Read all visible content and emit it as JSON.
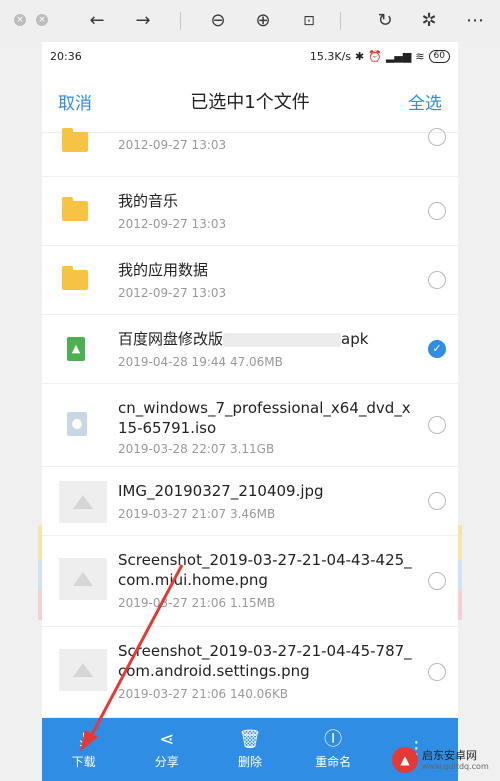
{
  "viewer": {
    "icons": [
      "close-icon",
      "back-icon",
      "forward-icon",
      "zoom-out-icon",
      "zoom-in-icon",
      "fit-icon",
      "rotate-icon",
      "magic-icon",
      "more-icon"
    ]
  },
  "status": {
    "time": "20:36",
    "speed": "15.3K/s",
    "battery": "60"
  },
  "header": {
    "cancel": "取消",
    "title": "已选中1个文件",
    "select_all": "全选"
  },
  "files": [
    {
      "name": "",
      "meta": "2012-09-27  13:03",
      "type": "folder",
      "checked": false
    },
    {
      "name": "我的音乐",
      "meta": "2012-09-27  13:03",
      "type": "folder",
      "checked": false
    },
    {
      "name": "我的应用数据",
      "meta": "2012-09-27  13:03",
      "type": "folder",
      "checked": false
    },
    {
      "name_prefix": "百度网盘修改版",
      "name_suffix": "apk",
      "meta": "2019-04-28  19:44  47.06MB",
      "type": "apk",
      "checked": true
    },
    {
      "name": "cn_windows_7_professional_x64_dvd_x15-65791.iso",
      "meta": "2019-03-28  22:07  3.11GB",
      "type": "iso",
      "checked": false
    },
    {
      "name": "IMG_20190327_210409.jpg",
      "meta": "2019-03-27  21:07  3.46MB",
      "type": "image",
      "checked": false
    },
    {
      "name": "Screenshot_2019-03-27-21-04-43-425_com.miui.home.png",
      "meta": "2019-03-27  21:06  1.15MB",
      "type": "image",
      "checked": false
    },
    {
      "name": "Screenshot_2019-03-27-21-04-45-787_com.android.settings.png",
      "meta": "2019-03-27  21:06  140.06KB",
      "type": "image",
      "checked": false
    }
  ],
  "bottom_bar": {
    "download": "下载",
    "share": "分享",
    "delete": "删除",
    "rename": "重命名"
  },
  "watermark": {
    "title": "启东安卓网",
    "url": "www.qdltdq.com"
  },
  "colors": {
    "accent": "#2f8de4",
    "folder": "#f6c343",
    "arrow": "#e53935"
  }
}
